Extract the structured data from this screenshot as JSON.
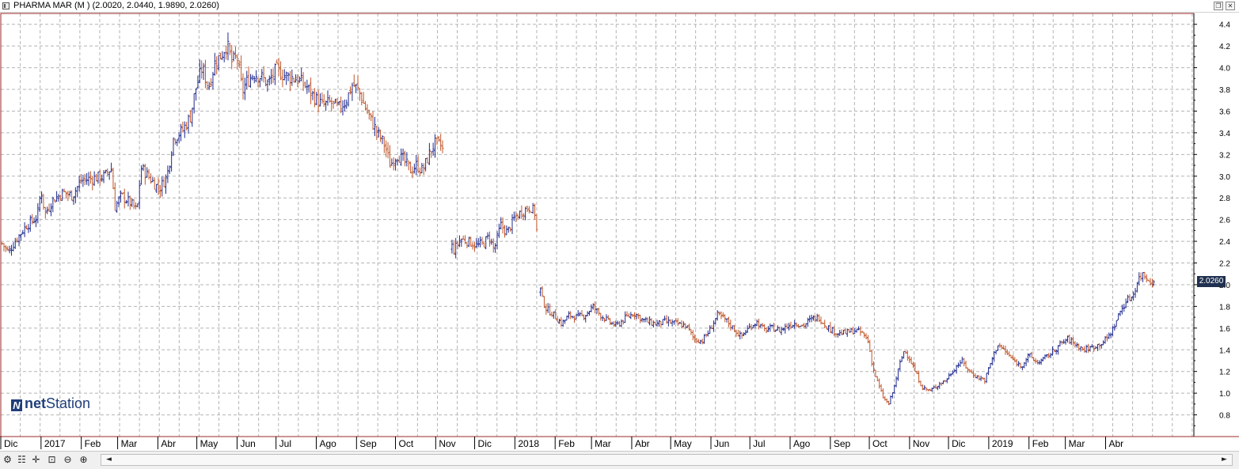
{
  "window": {
    "title": "PHARMA MAR (M ) (2.0020, 2.0440, 1.9890, 2.0260)",
    "restore_icon": "restore-icon",
    "close_icon": "close-icon"
  },
  "logo": {
    "mark": "N",
    "part1": "net",
    "part2": "Station"
  },
  "last_price_label": "2.0260",
  "colors": {
    "up": "#1f2a8f",
    "down": "#c0562a",
    "grid": "#b4b4b4",
    "frame": "#9c2a2a",
    "axis": "#000000",
    "badge": "#1f3050"
  },
  "toolbar": {
    "icons": [
      "chart-settings-icon",
      "indicators-icon",
      "crosshair-icon",
      "zoom-fit-icon",
      "zoom-out-icon",
      "zoom-in-icon"
    ],
    "scroll_left": "◄",
    "scroll_right": "►"
  },
  "chart_data": {
    "type": "bar",
    "subtype": "ohlc",
    "title": "",
    "ylim": [
      0.6,
      4.5
    ],
    "y_ticks": [
      0.8,
      1.0,
      1.2,
      1.4,
      1.6,
      1.8,
      2.0,
      2.2,
      2.4,
      2.6,
      2.8,
      3.0,
      3.2,
      3.4,
      3.6,
      3.8,
      4.0,
      4.2,
      4.4
    ],
    "y_tick_labels": [
      "0.8",
      "1.0",
      "1.2",
      "1.4",
      "1.6",
      "1.8",
      "2.0",
      "2.2",
      "2.4",
      "2.6",
      "2.8",
      "3.0",
      "3.2",
      "3.4",
      "3.6",
      "3.8",
      "4.0",
      "4.2",
      "4.4"
    ],
    "x_range_days": [
      0,
      919
    ],
    "x_labels": [
      {
        "label": "Dic",
        "day": 0
      },
      {
        "label": "2017",
        "day": 31
      },
      {
        "label": "Feb",
        "day": 62
      },
      {
        "label": "Mar",
        "day": 90
      },
      {
        "label": "Abr",
        "day": 121
      },
      {
        "label": "May",
        "day": 151
      },
      {
        "label": "Jun",
        "day": 182
      },
      {
        "label": "Jul",
        "day": 212
      },
      {
        "label": "Ago",
        "day": 243
      },
      {
        "label": "Sep",
        "day": 274
      },
      {
        "label": "Oct",
        "day": 304
      },
      {
        "label": "Nov",
        "day": 335
      },
      {
        "label": "Dic",
        "day": 365
      },
      {
        "label": "2018",
        "day": 396
      },
      {
        "label": "Feb",
        "day": 427
      },
      {
        "label": "Mar",
        "day": 455
      },
      {
        "label": "Abr",
        "day": 486
      },
      {
        "label": "May",
        "day": 516
      },
      {
        "label": "Jun",
        "day": 547
      },
      {
        "label": "Jul",
        "day": 577
      },
      {
        "label": "Ago",
        "day": 608
      },
      {
        "label": "Sep",
        "day": 639
      },
      {
        "label": "Oct",
        "day": 669
      },
      {
        "label": "Nov",
        "day": 700
      },
      {
        "label": "Dic",
        "day": 730
      },
      {
        "label": "2019",
        "day": 761
      },
      {
        "label": "Feb",
        "day": 792
      },
      {
        "label": "Mar",
        "day": 820
      },
      {
        "label": "Abr",
        "day": 851
      }
    ],
    "price_path": [
      [
        1,
        2.38
      ],
      [
        6,
        2.3
      ],
      [
        12,
        2.42
      ],
      [
        20,
        2.55
      ],
      [
        28,
        2.62
      ],
      [
        31,
        2.88
      ],
      [
        34,
        2.65
      ],
      [
        40,
        2.78
      ],
      [
        48,
        2.85
      ],
      [
        55,
        2.82
      ],
      [
        62,
        2.96
      ],
      [
        70,
        2.98
      ],
      [
        80,
        3.0
      ],
      [
        85,
        3.08
      ],
      [
        88,
        2.72
      ],
      [
        93,
        2.82
      ],
      [
        100,
        2.75
      ],
      [
        105,
        2.68
      ],
      [
        108,
        3.08
      ],
      [
        115,
        2.98
      ],
      [
        122,
        2.88
      ],
      [
        128,
        3.0
      ],
      [
        133,
        3.35
      ],
      [
        140,
        3.42
      ],
      [
        146,
        3.55
      ],
      [
        150,
        3.8
      ],
      [
        155,
        4.0
      ],
      [
        160,
        3.82
      ],
      [
        165,
        4.05
      ],
      [
        170,
        4.12
      ],
      [
        174,
        4.22
      ],
      [
        178,
        4.05
      ],
      [
        182,
        4.1
      ],
      [
        186,
        3.78
      ],
      [
        190,
        3.88
      ],
      [
        195,
        3.95
      ],
      [
        200,
        3.92
      ],
      [
        206,
        3.85
      ],
      [
        212,
        3.98
      ],
      [
        220,
        3.92
      ],
      [
        228,
        3.9
      ],
      [
        236,
        3.82
      ],
      [
        242,
        3.72
      ],
      [
        248,
        3.65
      ],
      [
        254,
        3.68
      ],
      [
        260,
        3.62
      ],
      [
        266,
        3.7
      ],
      [
        271,
        3.85
      ],
      [
        276,
        3.78
      ],
      [
        280,
        3.65
      ],
      [
        285,
        3.52
      ],
      [
        290,
        3.4
      ],
      [
        296,
        3.28
      ],
      [
        300,
        3.1
      ],
      [
        305,
        3.2
      ],
      [
        310,
        3.15
      ],
      [
        316,
        3.05
      ],
      [
        320,
        3.1
      ],
      [
        325,
        3.05
      ],
      [
        330,
        3.2
      ],
      [
        334,
        3.3
      ],
      [
        340,
        3.28
      ],
      [
        348,
        2.3
      ],
      [
        354,
        2.42
      ],
      [
        360,
        2.4
      ],
      [
        366,
        2.36
      ],
      [
        372,
        2.38
      ],
      [
        376,
        2.45
      ],
      [
        380,
        2.32
      ],
      [
        385,
        2.55
      ],
      [
        390,
        2.48
      ],
      [
        396,
        2.62
      ],
      [
        402,
        2.68
      ],
      [
        408,
        2.72
      ],
      [
        412,
        2.65
      ],
      [
        416,
        1.9
      ],
      [
        420,
        1.78
      ],
      [
        426,
        1.72
      ],
      [
        432,
        1.64
      ],
      [
        438,
        1.72
      ],
      [
        444,
        1.7
      ],
      [
        450,
        1.72
      ],
      [
        456,
        1.8
      ],
      [
        462,
        1.72
      ],
      [
        468,
        1.66
      ],
      [
        474,
        1.62
      ],
      [
        482,
        1.7
      ],
      [
        488,
        1.74
      ],
      [
        494,
        1.68
      ],
      [
        500,
        1.65
      ],
      [
        506,
        1.64
      ],
      [
        512,
        1.66
      ],
      [
        520,
        1.64
      ],
      [
        528,
        1.62
      ],
      [
        534,
        1.5
      ],
      [
        540,
        1.48
      ],
      [
        546,
        1.58
      ],
      [
        552,
        1.72
      ],
      [
        558,
        1.68
      ],
      [
        564,
        1.6
      ],
      [
        570,
        1.52
      ],
      [
        576,
        1.6
      ],
      [
        582,
        1.66
      ],
      [
        588,
        1.58
      ],
      [
        594,
        1.6
      ],
      [
        600,
        1.58
      ],
      [
        606,
        1.62
      ],
      [
        612,
        1.65
      ],
      [
        618,
        1.62
      ],
      [
        624,
        1.68
      ],
      [
        630,
        1.7
      ],
      [
        636,
        1.62
      ],
      [
        640,
        1.58
      ],
      [
        646,
        1.55
      ],
      [
        652,
        1.56
      ],
      [
        658,
        1.58
      ],
      [
        664,
        1.55
      ],
      [
        668,
        1.48
      ],
      [
        672,
        1.22
      ],
      [
        676,
        1.08
      ],
      [
        680,
        0.95
      ],
      [
        684,
        0.9
      ],
      [
        688,
        1.05
      ],
      [
        692,
        1.25
      ],
      [
        696,
        1.4
      ],
      [
        700,
        1.32
      ],
      [
        705,
        1.18
      ],
      [
        710,
        1.05
      ],
      [
        716,
        1.02
      ],
      [
        722,
        1.08
      ],
      [
        728,
        1.12
      ],
      [
        734,
        1.22
      ],
      [
        740,
        1.3
      ],
      [
        746,
        1.2
      ],
      [
        752,
        1.15
      ],
      [
        758,
        1.12
      ],
      [
        763,
        1.3
      ],
      [
        768,
        1.45
      ],
      [
        774,
        1.38
      ],
      [
        780,
        1.3
      ],
      [
        786,
        1.25
      ],
      [
        792,
        1.35
      ],
      [
        798,
        1.28
      ],
      [
        804,
        1.32
      ],
      [
        810,
        1.38
      ],
      [
        816,
        1.45
      ],
      [
        822,
        1.5
      ],
      [
        828,
        1.45
      ],
      [
        834,
        1.4
      ],
      [
        840,
        1.42
      ],
      [
        846,
        1.45
      ],
      [
        852,
        1.5
      ],
      [
        857,
        1.6
      ],
      [
        862,
        1.75
      ],
      [
        867,
        1.85
      ],
      [
        872,
        1.9
      ],
      [
        876,
        2.05
      ],
      [
        880,
        2.1
      ],
      [
        884,
        2.05
      ],
      [
        887,
        2.02
      ]
    ],
    "gaps": [
      [
        341,
        347
      ],
      [
        413,
        415
      ]
    ],
    "last": {
      "open": 2.002,
      "high": 2.044,
      "low": 1.989,
      "close": 2.026
    }
  }
}
